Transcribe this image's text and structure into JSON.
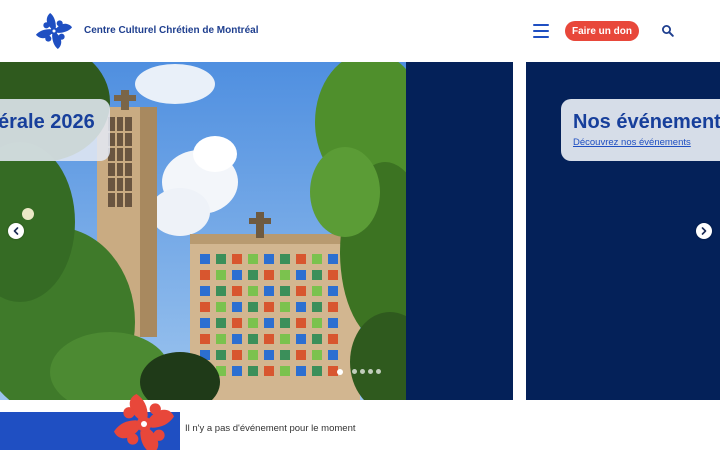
{
  "header": {
    "site_name": "Centre Culturel Chrétien de Montréal",
    "menu_icon": "hamburger-menu-icon",
    "donate_label": "Faire un don",
    "search_icon": "search-icon",
    "logo_icon": "pinwheel-logo-icon"
  },
  "carousel": {
    "slides": [
      {
        "title": "érale 2026"
      },
      {
        "title": "Nos événement",
        "link": "Découvrez nos événements"
      }
    ],
    "prev_icon": "chevron-left-icon",
    "next_icon": "chevron-right-icon",
    "dot_count": 5,
    "active_dot": 1
  },
  "events": {
    "empty_message": "Il n'y a pas d'événement pour le moment"
  },
  "colors": {
    "brand_blue": "#1f4fc2",
    "navy": "#042159",
    "accent_red": "#e8473a",
    "title_blue": "#173f9b"
  }
}
